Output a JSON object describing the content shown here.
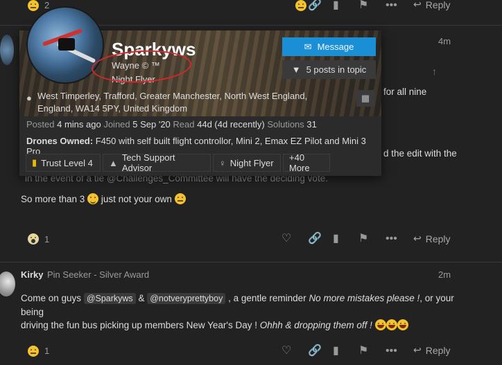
{
  "top_bar": {
    "count": "2",
    "reply_label": "Reply"
  },
  "post1": {
    "time": "4m",
    "partial_line1": "for all nine",
    "partial_line2": "d the edit with the",
    "partial_line3": "in the event of a tie  @Challenges_Committee  will have the deciding vote.",
    "line_main": "So more than 3",
    "line_main2": "just not your own",
    "like_count": "1",
    "reply_label": "Reply"
  },
  "card": {
    "username": "Sparkyws",
    "name": "Wayne © ™",
    "title": "Night Flyer",
    "message_button": "Message",
    "posts_in_topic": "5 posts in topic",
    "location": "West Timperley, Trafford, Greater Manchester, North West England, England, WA14 5PY, United Kingdom",
    "posted_label": "Posted",
    "posted_value": "4 mins ago",
    "joined_label": "Joined",
    "joined_value": "5 Sep '20",
    "read_label": "Read",
    "read_value": "44d (4d recently)",
    "solutions_label": "Solutions",
    "solutions_value": "31",
    "drones_label": "Drones Owned:",
    "drones_value": "F450 with self built flight controllor, Mini 2, Emax EZ Pilot and Mini 3 Pro",
    "badges": [
      "Trust Level 4",
      "Tech Support Advisor",
      "Night Flyer",
      "+40 More"
    ]
  },
  "post2": {
    "author": "Kirky",
    "author_title": "Pin Seeker - Silver Award",
    "time": "2m",
    "text_a": "Come on guys",
    "mention_a": "@Sparkyws",
    "amp": "&",
    "mention_b": "@notveryprettyboy",
    "text_b": ", a gentle reminder",
    "italic_a": "No more mistakes please !",
    "text_c": ", or your being",
    "text_d": "driving the fun bus picking up members New Year's Day !",
    "italic_b": "Ohhh & dropping them off !",
    "reply_label": "Reply",
    "like_count": "1"
  },
  "colors": {
    "accent": "#1a8fd6",
    "annotation": "#d8262b",
    "background": "#222222"
  },
  "icons": [
    "heart-icon",
    "link-icon",
    "bookmark-icon",
    "flag-icon",
    "more-icon",
    "reply-icon",
    "envelope-icon",
    "filter-icon",
    "map-pin-icon",
    "map-icon",
    "user-icon",
    "lightbulb-icon",
    "arrow-up-icon"
  ]
}
